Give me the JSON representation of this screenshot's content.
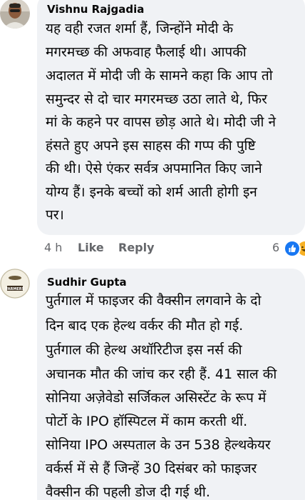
{
  "comments": [
    {
      "author": "Vishnu Rajgadia",
      "lines": [
        "यह वही रजत शर्मा हैं, जिन्होंने मोदी के",
        "मगरमच्छ की अफवाह फैलाई थी। आपकी",
        "अदालत में मोदी जी के सामने कहा कि आप तो",
        "समुन्दर से दो चार मगरमच्छ उठा लाते थे, फिर",
        "मां के कहने पर वापस छोड़ आते थे। मोदी जी ने",
        "हंसते हुए अपने इस साहस की गप्प की पुष्टि",
        "की थी। ऐसे एंकर सर्वत्र अपमानित किए जाने",
        "योग्य हैं। इनके बच्चों को शर्म आती होगी इन",
        "पर।"
      ],
      "time": "4 h",
      "like_label": "Like",
      "reply_label": "Reply",
      "reaction_count": "6",
      "reactions": [
        "like-icon",
        "haha-icon"
      ]
    },
    {
      "author": "Sudhir Gupta",
      "avatar_text": "FARMERS",
      "lines": [
        "पुर्तगाल में फाइजर की वैक्सीन लगवाने के दो",
        "दिन बाद एक हेल्थ वर्कर की मौत हो गई.",
        "पुर्तगाल की हेल्थ अथॉरिटीज इस नर्स की",
        "अचानक मौत की जांच कर रही हैं. 41 साल की",
        "सोनिया अज़ेवेडो सर्जिकल असिस्टेंट के रूप में",
        "पोर्टो के IPO हॉस्पिटल में काम करती थीं.",
        "सोनिया IPO अस्पताल के उन 538 हेल्थकेयर",
        "वर्कर्स में से हैं जिन्हें 30 दिसंबर को फाइजर",
        "वैक्सीन की पहली डोज दी गई थी."
      ]
    }
  ],
  "colors": {
    "bubble": "#f0f2f5",
    "text": "#050505",
    "meta": "#65676b",
    "like_blue": "#1877f2"
  }
}
